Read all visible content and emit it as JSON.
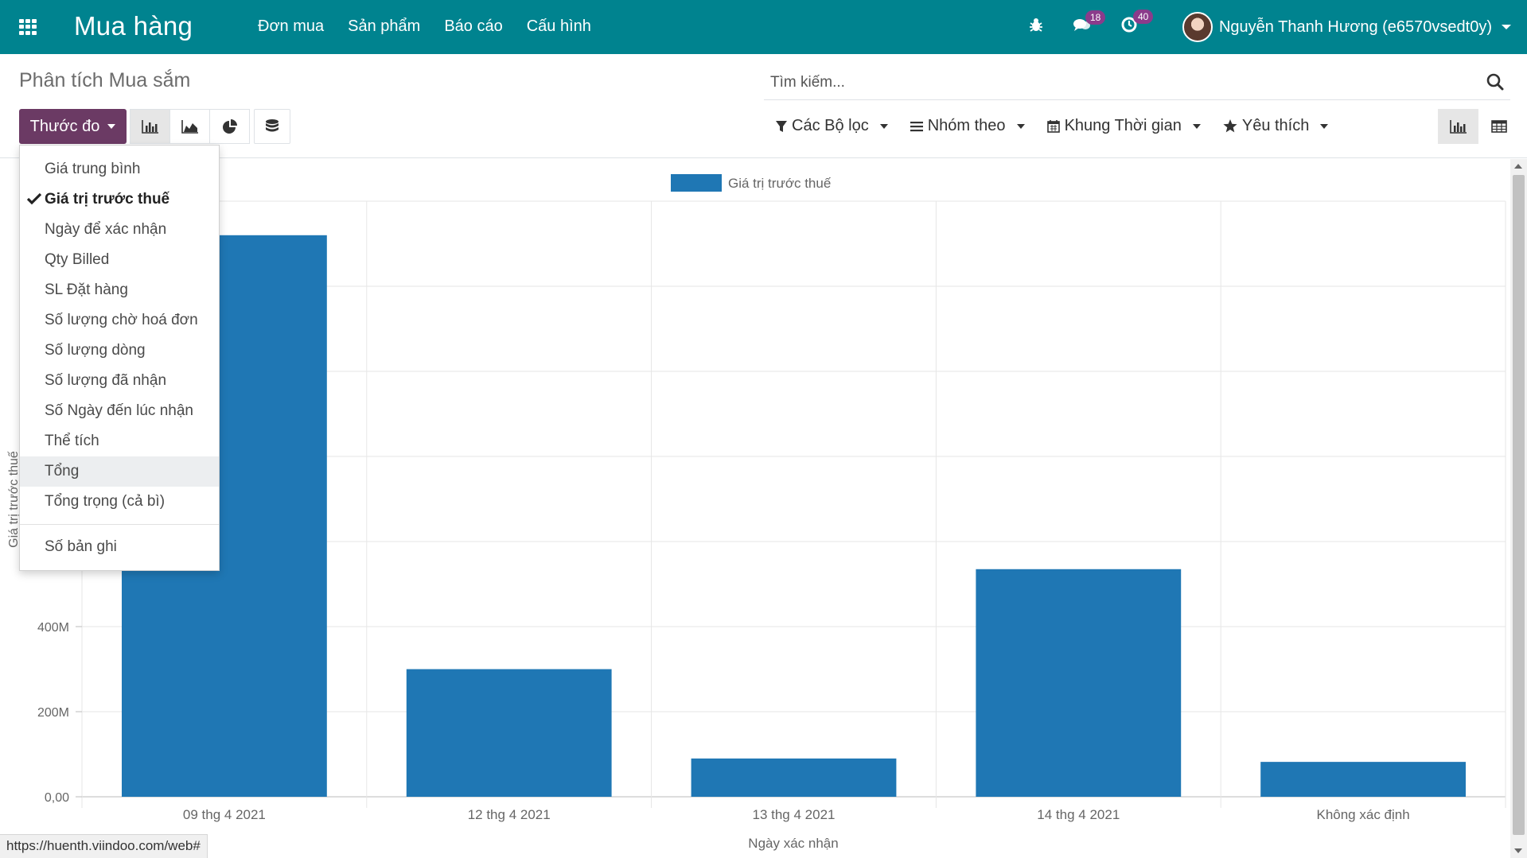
{
  "navbar": {
    "brand": "Mua hàng",
    "menu": [
      "Đơn mua",
      "Sản phẩm",
      "Báo cáo",
      "Cấu hình"
    ],
    "messages_count": "18",
    "activities_count": "40",
    "user_name": "Nguyễn Thanh Hương (e6570vsedt0y)",
    "bg_color": "#00838f"
  },
  "control": {
    "title": "Phân tích Mua sắm",
    "search_placeholder": "Tìm kiếm...",
    "measure_label": "Thước đo",
    "filters_label": "Các Bộ lọc",
    "groupby_label": "Nhóm theo",
    "timerange_label": "Khung Thời gian",
    "favorites_label": "Yêu thích",
    "accent_color": "#6b3a64"
  },
  "measures": {
    "items": [
      {
        "label": "Giá trung bình",
        "selected": false
      },
      {
        "label": "Giá trị trước thuế",
        "selected": true
      },
      {
        "label": "Ngày để xác nhận",
        "selected": false
      },
      {
        "label": "Qty Billed",
        "selected": false
      },
      {
        "label": "SL Đặt hàng",
        "selected": false
      },
      {
        "label": "Số lượng chờ hoá đơn",
        "selected": false
      },
      {
        "label": "Số lượng dòng",
        "selected": false
      },
      {
        "label": "Số lượng đã nhận",
        "selected": false
      },
      {
        "label": "Số Ngày đến lúc nhận",
        "selected": false
      },
      {
        "label": "Thể tích",
        "selected": false
      },
      {
        "label": "Tổng",
        "selected": false,
        "hover": true
      },
      {
        "label": "Tổng trọng (cả bì)",
        "selected": false
      }
    ],
    "count_label": "Số bản ghi"
  },
  "chart_data": {
    "type": "bar",
    "categories": [
      "09 thg 4 2021",
      "12 thg 4 2021",
      "13 thg 4 2021",
      "14 thg 4 2021",
      "Không xác định"
    ],
    "series": [
      {
        "name": "Giá trị trước thuế",
        "values": [
          1320000000,
          300000000,
          90000000,
          535000000,
          82000000
        ],
        "color": "#1f77b4"
      }
    ],
    "xlabel": "Ngày xác nhận",
    "ylabel": "Giá trị trước thuế",
    "ylim": [
      0,
      1400000000
    ],
    "yticks": [
      0,
      200000000,
      400000000
    ],
    "ytick_labels": [
      "0,00",
      "200M",
      "400M"
    ],
    "legend_position": "top",
    "grid": true
  },
  "status_url": "https://huenth.viindoo.com/web#"
}
